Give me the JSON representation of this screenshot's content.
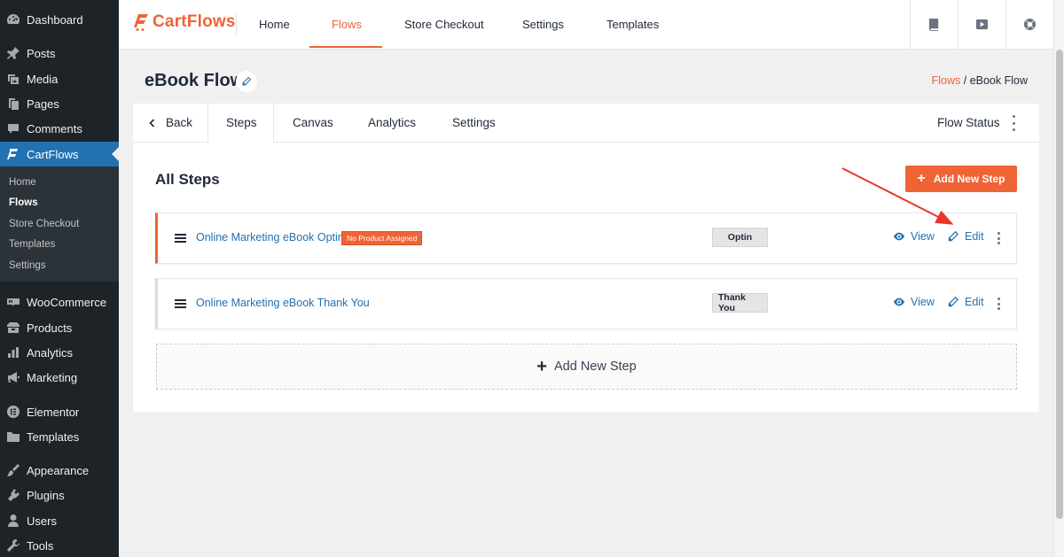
{
  "wp_sidebar": {
    "items": [
      {
        "label": "Dashboard",
        "icon": "dashboard-icon"
      },
      {
        "label": "Posts",
        "icon": "pin-icon"
      },
      {
        "label": "Media",
        "icon": "media-icon"
      },
      {
        "label": "Pages",
        "icon": "pages-icon"
      },
      {
        "label": "Comments",
        "icon": "comments-icon"
      },
      {
        "label": "CartFlows",
        "icon": "cartflows-icon"
      },
      {
        "label": "WooCommerce",
        "icon": "woocommerce-icon"
      },
      {
        "label": "Products",
        "icon": "products-icon"
      },
      {
        "label": "Analytics",
        "icon": "analytics-icon"
      },
      {
        "label": "Marketing",
        "icon": "megaphone-icon"
      },
      {
        "label": "Elementor",
        "icon": "elementor-icon"
      },
      {
        "label": "Templates",
        "icon": "folder-icon"
      },
      {
        "label": "Appearance",
        "icon": "brush-icon"
      },
      {
        "label": "Plugins",
        "icon": "plugin-icon"
      },
      {
        "label": "Users",
        "icon": "user-icon"
      },
      {
        "label": "Tools",
        "icon": "wrench-icon"
      }
    ],
    "submenu": [
      "Home",
      "Flows",
      "Store Checkout",
      "Templates",
      "Settings"
    ]
  },
  "header": {
    "brand": "CartFlows",
    "nav": [
      "Home",
      "Flows",
      "Store Checkout",
      "Settings",
      "Templates"
    ],
    "active_nav": "Flows",
    "icons": [
      "book-icon",
      "youtube-icon",
      "support-icon"
    ]
  },
  "page": {
    "title": "eBook Flow",
    "breadcrumb_link": "Flows",
    "breadcrumb_sep": " / ",
    "breadcrumb_current": "eBook Flow"
  },
  "tabs": {
    "back": "Back",
    "items": [
      "Steps",
      "Canvas",
      "Analytics",
      "Settings"
    ],
    "active": "Steps",
    "flow_status": "Flow Status"
  },
  "steps": {
    "heading": "All Steps",
    "add_button": "Add New Step",
    "rows": [
      {
        "title": "Online Marketing eBook Optin",
        "badge": "No Product Assigned",
        "type": "Optin",
        "view": "View",
        "edit": "Edit"
      },
      {
        "title": "Online Marketing eBook Thank You",
        "badge": "",
        "type": "Thank You",
        "view": "View",
        "edit": "Edit"
      }
    ],
    "add_dashed": "Add New Step"
  },
  "colors": {
    "accent": "#f06335",
    "link": "#2271b1",
    "wp_sidebar_bg": "#1d2327",
    "wp_active": "#2271b1",
    "annotation_arrow": "#e8372a"
  }
}
